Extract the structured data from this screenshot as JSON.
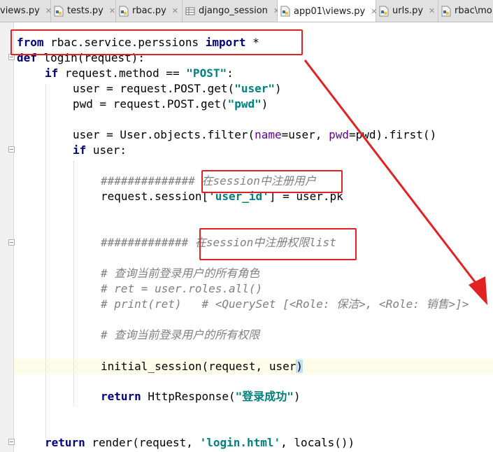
{
  "tabs": [
    {
      "label": "views.py",
      "icon": "python-file-icon",
      "active": false
    },
    {
      "label": "tests.py",
      "icon": "python-file-icon",
      "active": false
    },
    {
      "label": "rbac.py",
      "icon": "python-file-icon",
      "active": false
    },
    {
      "label": "django_session",
      "icon": "table-icon",
      "active": false
    },
    {
      "label": "app01\\views.py",
      "icon": "python-file-icon",
      "active": true
    },
    {
      "label": "urls.py",
      "icon": "python-file-icon",
      "active": false
    },
    {
      "label": "rbac\\mo",
      "icon": "python-file-icon",
      "active": false
    }
  ],
  "code": {
    "l1_from": "from",
    "l1_mod": " rbac.service.perssions ",
    "l1_import": "import",
    "l1_star": " *",
    "l2_def": "def",
    "l2_rest": " login(request):",
    "l3_if": "if",
    "l3_rest": " request.method == ",
    "l3_str": "\"POST\"",
    "l3_colon": ":",
    "l4_a": "user = request.POST.get(",
    "l4_str": "\"user\"",
    "l4_b": ")",
    "l5_a": "pwd = request.POST.get(",
    "l5_str": "\"pwd\"",
    "l5_b": ")",
    "l7_a": "user = User.objects.filter(",
    "l7_p1": "name",
    "l7_b": "=user, ",
    "l7_p2": "pwd",
    "l7_c": "=pwd).first()",
    "l8_if": "if",
    "l8_rest": " user:",
    "l10_cmt": "############## 在session中注册用户",
    "l11_a": "request.session[",
    "l11_str": "'user_id'",
    "l11_b": "] = user.pk",
    "l14_cmt": "############# 在session中注册权限list",
    "l16_cmt": "# 查询当前登录用户的所有角色",
    "l17_cmt": "# ret = user.roles.all()",
    "l18_cmt": "# print(ret)   # <QuerySet [<Role: 保洁>, <Role: 销售>]>",
    "l20_cmt": "# 查询当前登录用户的所有权限",
    "l22_a": "initial_session(request, user",
    "l22_b": ")",
    "l24_ret": "return",
    "l24_a": " HttpResponse(",
    "l24_str": "\"登录成功\"",
    "l24_b": ")",
    "l27_ret": "return",
    "l27_a": " render(request, ",
    "l27_str": "'login.html'",
    "l27_b": ", locals())"
  },
  "colors": {
    "annotation": "#e22222",
    "keyword": "#000080",
    "string": "#008080",
    "comment": "#808080",
    "current_line": "#fdfce8"
  }
}
